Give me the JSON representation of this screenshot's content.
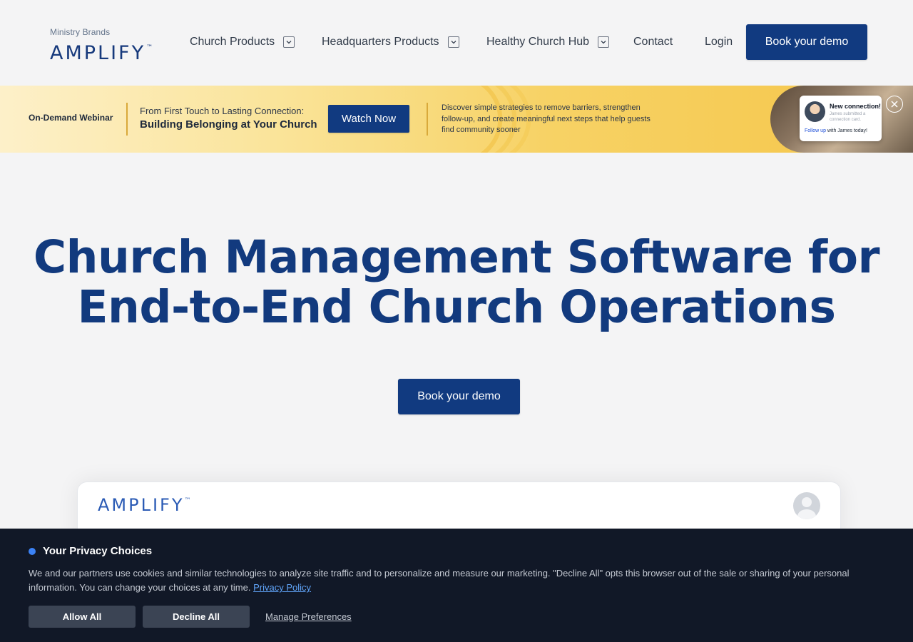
{
  "header": {
    "logo_small": "Ministry Brands",
    "logo_big": "AMPLIFY",
    "logo_tm": "™",
    "nav": {
      "church_products": "Church Products",
      "headquarters_products": "Headquarters Products",
      "healthy_church_hub": "Healthy Church Hub",
      "contact": "Contact",
      "login": "Login"
    },
    "cta_label": "Book your demo"
  },
  "banner": {
    "label": "On-Demand Webinar",
    "subtitle": "From First Touch to Lasting Connection:",
    "title": "Building Belonging at Your Church",
    "cta_label": "Watch Now",
    "description": "Discover simple strategies to remove barriers, strengthen follow-up, and create meaningful next steps that help guests find community sooner",
    "notification": {
      "title": "New connection!",
      "text": "James submitted a connection card.",
      "follow_prefix": "Follow up",
      "follow_suffix": " with James today!"
    }
  },
  "hero": {
    "title": "Church Management Software for End-to-End Church Operations",
    "cta_label": "Book your demo"
  },
  "preview": {
    "logo": "AMPLIFY",
    "logo_tm": "™"
  },
  "privacy": {
    "title": "Your Privacy Choices",
    "text": "We and our partners use cookies and similar technologies to analyze site traffic and to personalize and measure our marketing. \"Decline All\" opts this browser out of the sale or sharing of your personal information. You can change your choices at any time.",
    "policy_link": "Privacy Policy",
    "allow_label": "Allow All",
    "decline_label": "Decline All",
    "manage_label": "Manage Preferences"
  },
  "colors": {
    "brand_navy": "#113a80",
    "banner_gold": "#f5c64a",
    "privacy_bg": "#111827",
    "privacy_accent": "#3b82f6"
  }
}
